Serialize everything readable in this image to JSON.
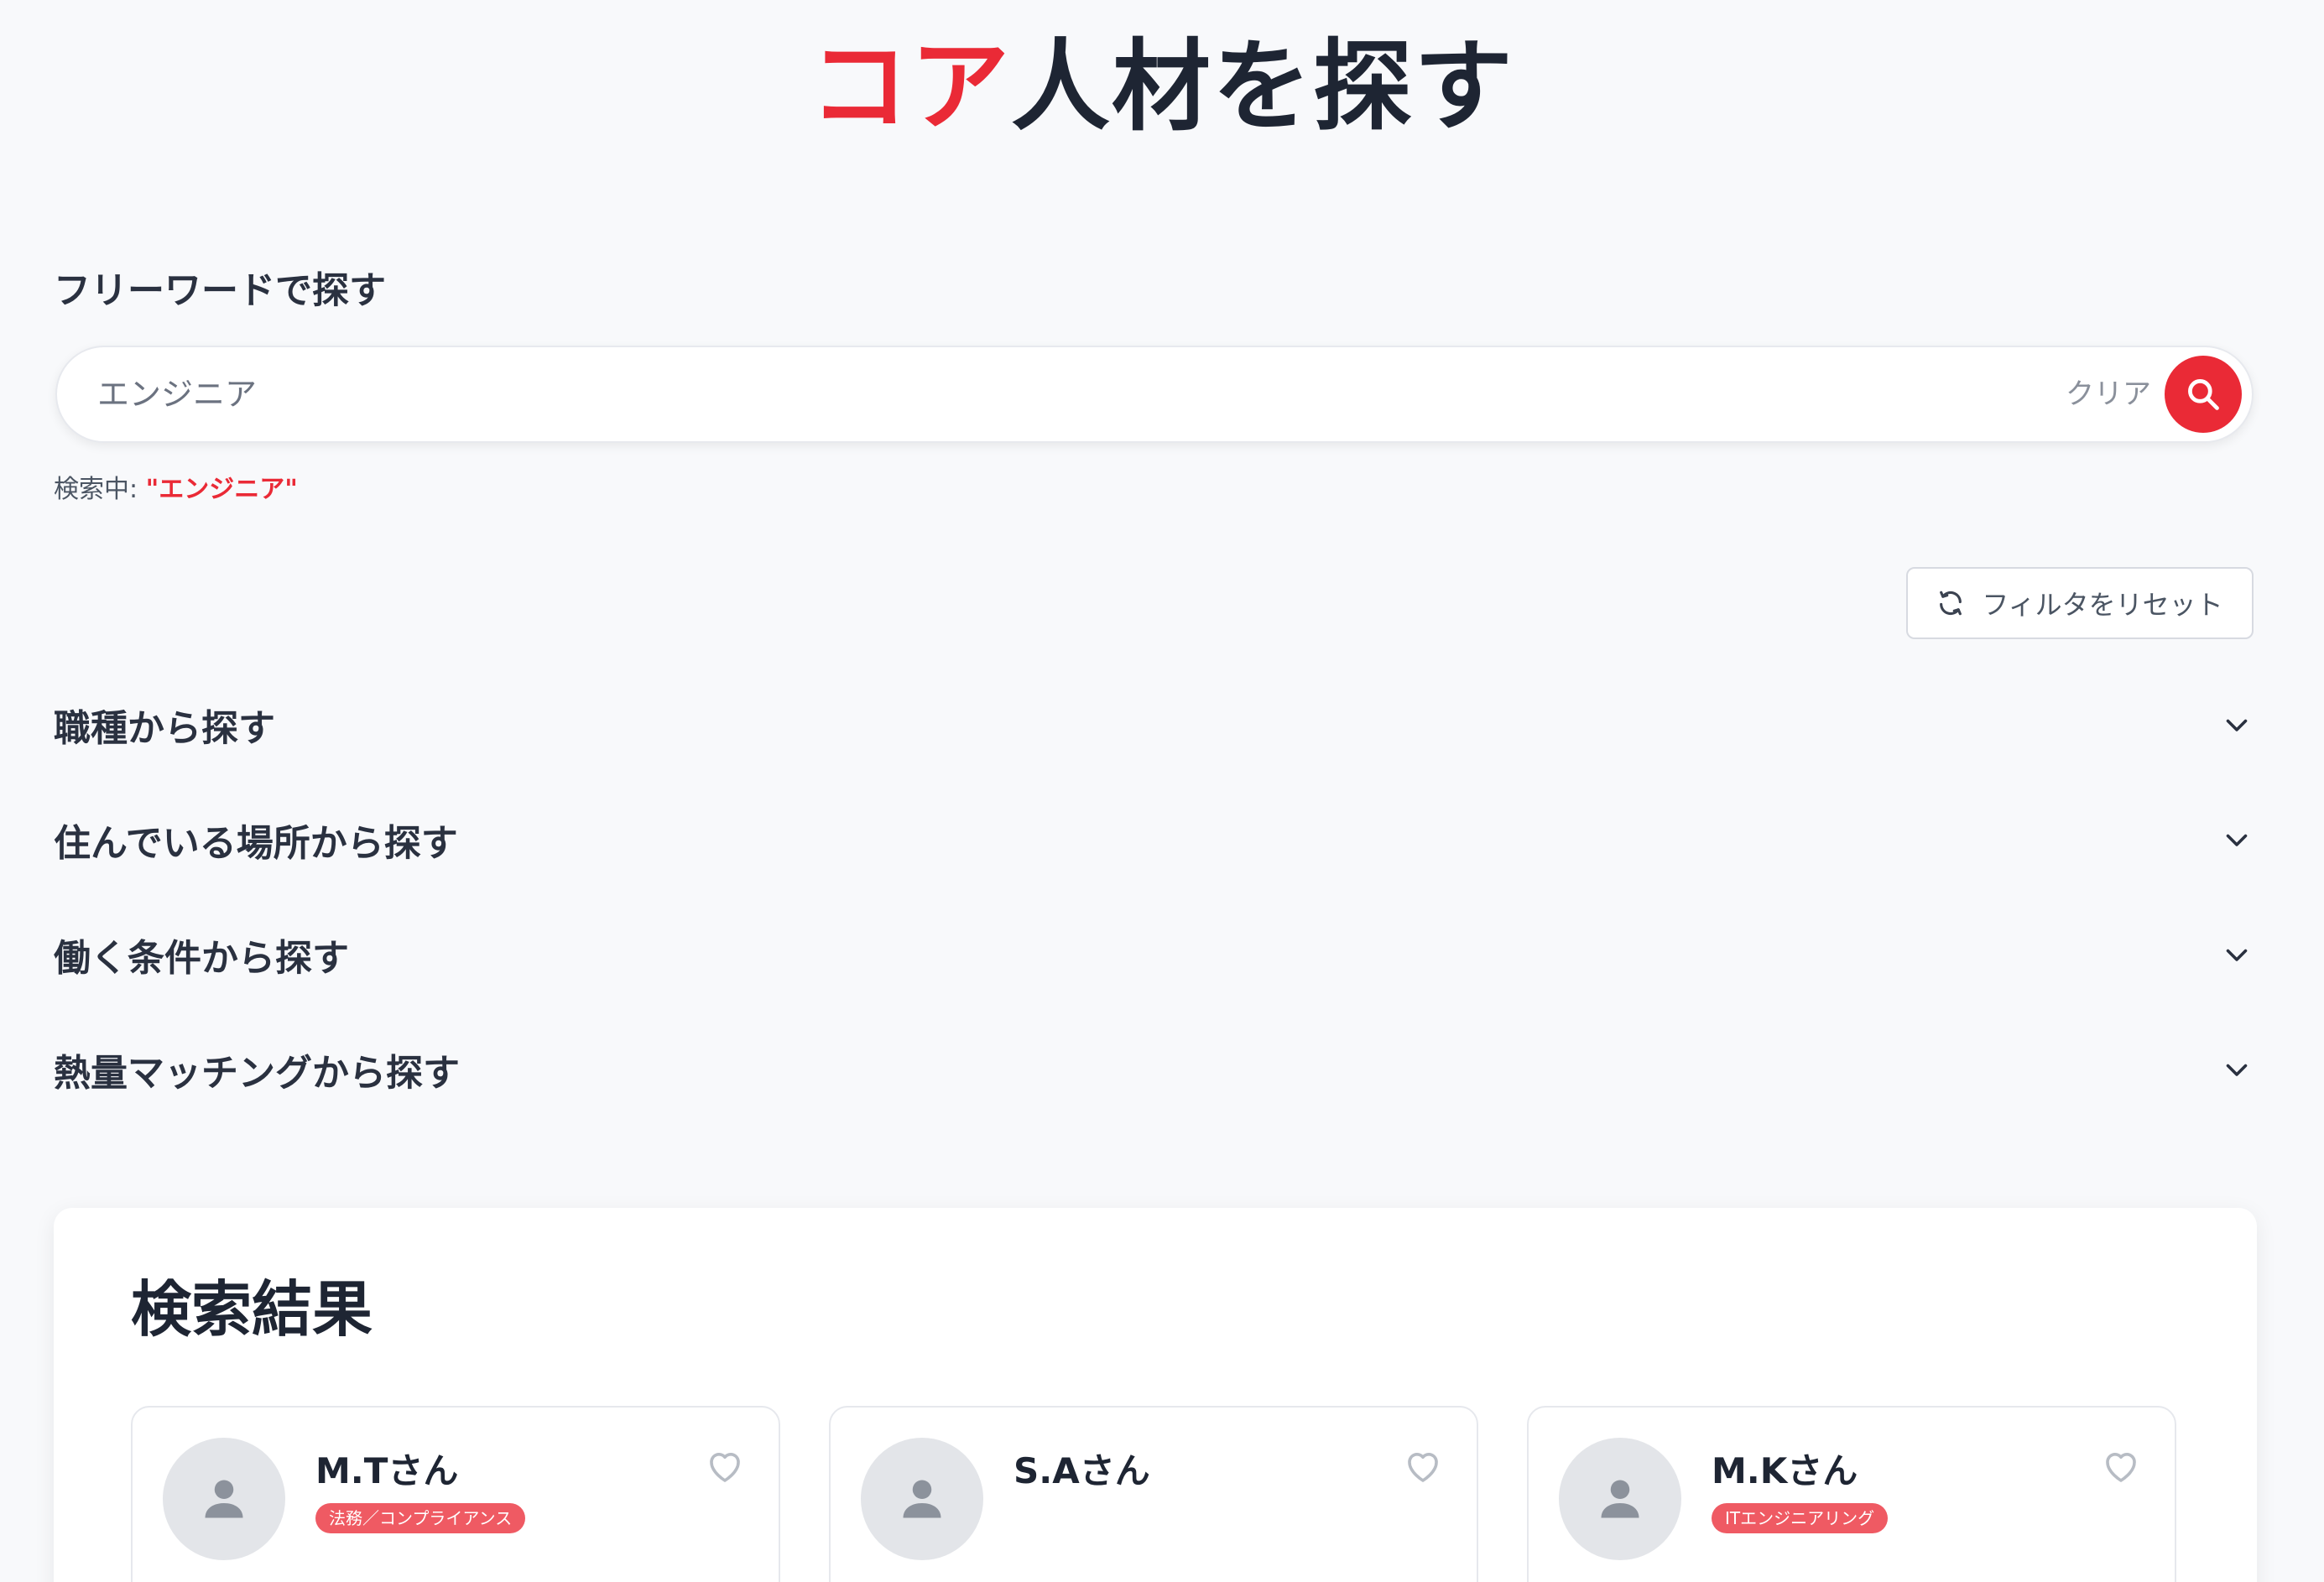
{
  "page": {
    "title_accent": "コア",
    "title_rest": "人材を探す"
  },
  "search": {
    "section_label": "フリーワードで探す",
    "value": "エンジニア",
    "clear_label": "クリア",
    "status_prefix": "検索中: ",
    "status_term": "\"エンジニア\"",
    "icon": "search-icon"
  },
  "filters": {
    "reset_label": "フィルタをリセット",
    "reset_icon": "refresh-icon",
    "sections": [
      {
        "label": "職種から探す"
      },
      {
        "label": "住んでいる場所から探す"
      },
      {
        "label": "働く条件から探す"
      },
      {
        "label": "熱量マッチングから探す"
      }
    ]
  },
  "results": {
    "title": "検索結果",
    "cards": [
      {
        "name": "M.Tさん",
        "tag": "法務／コンプライアンス"
      },
      {
        "name": "S.Aさん",
        "tag": ""
      },
      {
        "name": "M.Kさん",
        "tag": "ITエンジニアリング"
      }
    ]
  },
  "colors": {
    "accent": "#ea2a36",
    "background": "#f8f9fb",
    "text": "#1e2533",
    "tag": "#ef5a63"
  }
}
